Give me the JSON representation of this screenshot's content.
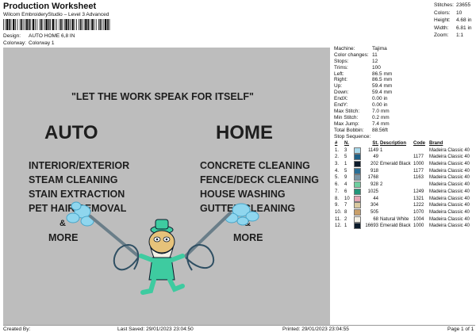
{
  "header": {
    "title": "Production Worksheet",
    "subtitle": "Wilcom EmbroideryStudio – Level 3 Advanced",
    "design_label": "Design:",
    "design_value": "AUTO HOME 6,8 IN",
    "colorway_label": "Colorway:",
    "colorway_value": "Colorway 1"
  },
  "stats": [
    {
      "label": "Stitches:",
      "value": "23655"
    },
    {
      "label": "Colors:",
      "value": "10"
    },
    {
      "label": "Height:",
      "value": "4.68 in"
    },
    {
      "label": "Width:",
      "value": "6.81 in"
    },
    {
      "label": "Zoom:",
      "value": "1:1"
    }
  ],
  "design": {
    "quote": "\"LET THE WORK SPEAK FOR ITSELF\"",
    "left_title": "AUTO",
    "right_title": "HOME",
    "left_lines": [
      "INTERIOR/EXTERIOR",
      "STEAM CLEANING",
      "STAIN EXTRACTION",
      "PET HAIR REMOVAL",
      "&",
      "MORE"
    ],
    "right_lines": [
      "CONCRETE CLEANING",
      "FENCE/DECK CLEANING",
      "HOUSE WASHING",
      "GUTTER CLEANING",
      "&",
      "MORE"
    ],
    "background": "#bdbdbd"
  },
  "properties": [
    {
      "label": "Machine:",
      "value": "Tajima"
    },
    {
      "label": "Color changes:",
      "value": "11"
    },
    {
      "label": "Stops:",
      "value": "12"
    },
    {
      "label": "Trims:",
      "value": "100"
    },
    {
      "label": "Left:",
      "value": "86.5 mm"
    },
    {
      "label": "Right:",
      "value": "86.5 mm"
    },
    {
      "label": "Up:",
      "value": "59.4 mm"
    },
    {
      "label": "Down:",
      "value": "59.4 mm"
    },
    {
      "label": "EndX:",
      "value": "0.00 in"
    },
    {
      "label": "EndY:",
      "value": "0.00 in"
    },
    {
      "label": "Max Stitch:",
      "value": "7.0 mm"
    },
    {
      "label": "Min Stitch:",
      "value": "0.2 mm"
    },
    {
      "label": "Max Jump:",
      "value": "7.4 mm"
    },
    {
      "label": "Total Bobbin:",
      "value": "88.56ft"
    }
  ],
  "sequence": {
    "title": "Stop Sequence:",
    "headers": [
      "#",
      "N.",
      "",
      "St.",
      "Description",
      "Code",
      "Brand"
    ],
    "rows": [
      {
        "n": "1.",
        "needle": "3",
        "color": "#a8d8ea",
        "st": "1149",
        "desc": "1",
        "code": "",
        "brand": "Madeira Classic 40"
      },
      {
        "n": "2.",
        "needle": "5",
        "color": "#1d5f86",
        "st": "49",
        "desc": "",
        "code": "1177",
        "brand": "Madeira Classic 40"
      },
      {
        "n": "3.",
        "needle": "1",
        "color": "#0b1a2a",
        "st": "202",
        "desc": "Emerald Black",
        "code": "1000",
        "brand": "Madeira Classic 40"
      },
      {
        "n": "4.",
        "needle": "5",
        "color": "#2a6f96",
        "st": "918",
        "desc": "",
        "code": "1177",
        "brand": "Madeira Classic 40"
      },
      {
        "n": "5.",
        "needle": "9",
        "color": "#7a96a6",
        "st": "1768",
        "desc": "",
        "code": "1163",
        "brand": "Madeira Classic 40"
      },
      {
        "n": "6.",
        "needle": "4",
        "color": "#6fcfa0",
        "st": "928",
        "desc": "2",
        "code": "",
        "brand": "Madeira Classic 40"
      },
      {
        "n": "7.",
        "needle": "6",
        "color": "#23957a",
        "st": "1025",
        "desc": "",
        "code": "1249",
        "brand": "Madeira Classic 40"
      },
      {
        "n": "8.",
        "needle": "10",
        "color": "#e5a6b4",
        "st": "44",
        "desc": "",
        "code": "1321",
        "brand": "Madeira Classic 40"
      },
      {
        "n": "9.",
        "needle": "7",
        "color": "#d9c9a0",
        "st": "304",
        "desc": "",
        "code": "1222",
        "brand": "Madeira Classic 40"
      },
      {
        "n": "10.",
        "needle": "8",
        "color": "#c9a06a",
        "st": "505",
        "desc": "",
        "code": "1070",
        "brand": "Madeira Classic 40"
      },
      {
        "n": "11.",
        "needle": "2",
        "color": "#f4f1e6",
        "st": "68",
        "desc": "Natural White",
        "code": "1004",
        "brand": "Madeira Classic 40"
      },
      {
        "n": "12.",
        "needle": "1",
        "color": "#0b1a2a",
        "st": "16693",
        "desc": "Emerald Black",
        "code": "1000",
        "brand": "Madeira Classic 40"
      }
    ]
  },
  "footer": {
    "created_by": "Created By:",
    "last_saved": "Last Saved: 29/01/2023 23:04:50",
    "printed": "Printed: 29/01/2023 23:04:55",
    "page": "Page 1 of 1"
  }
}
